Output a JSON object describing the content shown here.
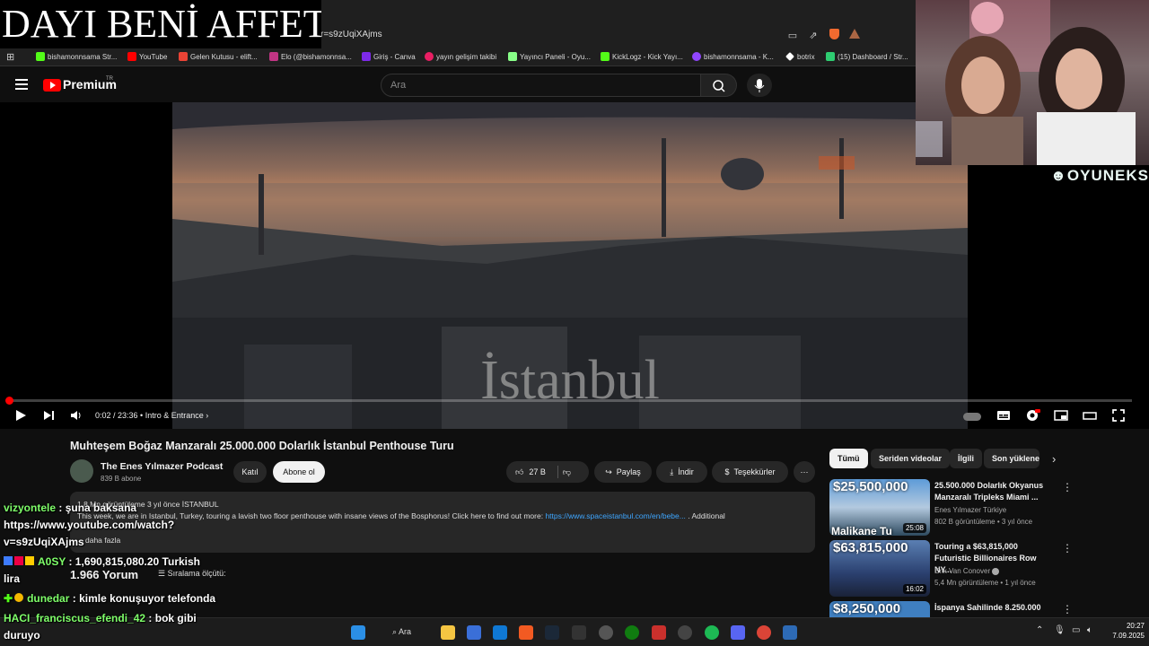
{
  "overlay": {
    "title": "DAYI BENİ AFFET",
    "brand": "OYUNEKS"
  },
  "browser": {
    "url": "r=s9zUqiXAjms",
    "bookmarks": [
      "bishamonnsama Str...",
      "YouTube",
      "Gelen Kutusu - elift...",
      "Elo (@bishamonnsa...",
      "Giriş - Canva",
      "yayın gelişim takibi",
      "Yayıncı Paneli - Oyu...",
      "KickLogz - Kick Yayı...",
      "bishamonnsama - K...",
      "botrix",
      "(15) Dashboard / Str..."
    ]
  },
  "youtube": {
    "logo": "Premium",
    "logo_sup": "TR",
    "search_placeholder": "Ara"
  },
  "player": {
    "overlay_text": "İstanbul",
    "time": "0:02 / 23:36",
    "chapter": "Intro & Entrance",
    "progress": 0.0014
  },
  "video": {
    "title": "Muhteşem Boğaz Manzaralı 25.000.000 Dolarlık İstanbul Penthouse Turu",
    "channel": "The Enes Yılmazer Podcast",
    "subs": "839 B abone",
    "join": "Katıl",
    "subscribe": "Abone ol",
    "likes": "27 B",
    "share": "Paylaş",
    "download": "İndir",
    "thanks": "Teşekkürler",
    "desc_meta": "1,8 Mn görüntüleme  3 yıl önce  İSTANBUL",
    "desc_text": "This week, we are in Istanbul, Turkey, touring a lavish two floor penthouse with insane views of the Bosphorus! Click here to find out more: ",
    "desc_link": "https://www.spaceistanbul.com/en/bebe...",
    "desc_tail": " . Additional",
    "more": "daha fazla",
    "comments": "1.966 Yorum",
    "sort": "Sıralama ölçütü:"
  },
  "chips": [
    "Tümü",
    "Seriden videolar",
    "İlgili",
    "Son yüklene"
  ],
  "related": [
    {
      "price": "$25,500,000",
      "caption": "Malikane Tu",
      "duration": "25:08",
      "title": "25.500.000 Dolarlık Okyanus Manzaralı Tripleks Miami ...",
      "channel": "Enes Yılmazer Türkiye",
      "meta": "802 B görüntüleme • 3 yıl önce"
    },
    {
      "price": "$63,815,000",
      "duration": "16:02",
      "title": "Touring a $63,815,000 Futuristic Billionaires Row NY...",
      "channel": "Erik Van Conover",
      "meta": "5,4 Mn görüntüleme • 1 yıl önce"
    },
    {
      "price": "$8,250,000",
      "title": "İspanya Sahilinde 8.250.000"
    }
  ],
  "chat": [
    {
      "user": "vizyontele",
      "text": " : şuna baksana"
    },
    {
      "text": "https://www.youtube.com/watch?"
    },
    {
      "text": "v=s9zUqiXAjms"
    },
    {
      "user": "A0SY",
      "text": " : 1,690,815,080.20 Turkish"
    },
    {
      "text": "lira"
    },
    {
      "user": "dunedar",
      "text": " : kimle konuşuyor telefonda"
    },
    {
      "user": "HACI_franciscus_efendi_42",
      "text": " : bok gibi"
    },
    {
      "text": "duruyo"
    }
  ],
  "taskbar": {
    "search": "Ara",
    "time": "20:27",
    "date": "7.09.2025"
  },
  "colors": {
    "accent": "#ff0000",
    "link": "#3ea6ff",
    "chat_user": "#7fff6a"
  }
}
